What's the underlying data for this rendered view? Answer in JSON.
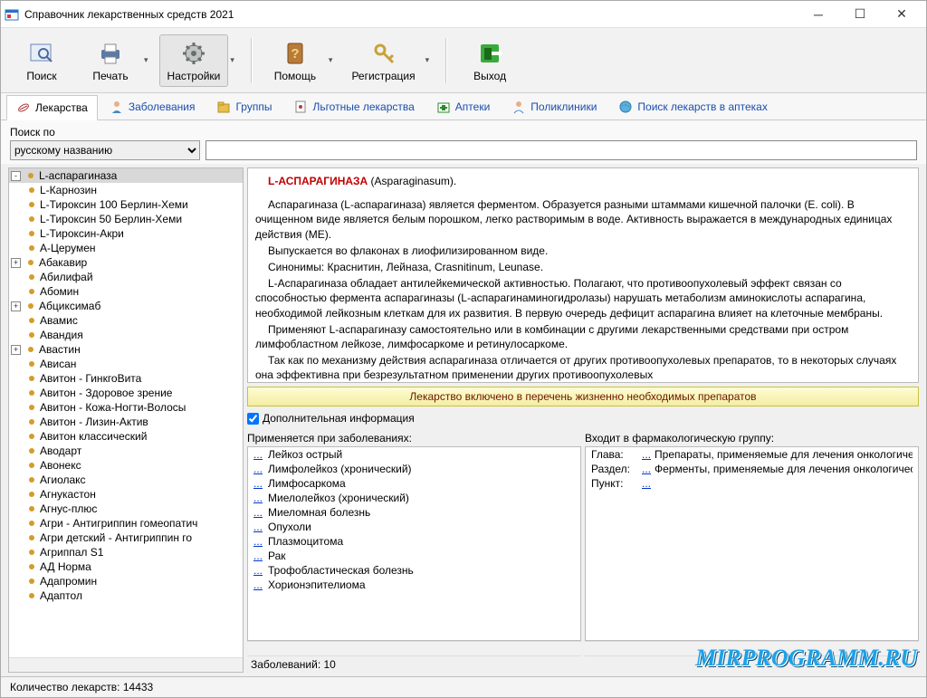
{
  "window": {
    "title": "Справочник лекарственных средств 2021"
  },
  "toolbar": {
    "search": "Поиск",
    "print": "Печать",
    "settings": "Настройки",
    "help": "Помощь",
    "register": "Регистрация",
    "exit": "Выход"
  },
  "tabs": {
    "drugs": "Лекарства",
    "diseases": "Заболевания",
    "groups": "Группы",
    "privileged": "Льготные лекарства",
    "pharmacies": "Аптеки",
    "clinics": "Поликлиники",
    "pharmsearch": "Поиск лекарств в аптеках"
  },
  "search": {
    "label": "Поиск по",
    "selected": "русскому названию",
    "value": ""
  },
  "tree": [
    {
      "label": "L-аспарагиназа",
      "expander": "-",
      "level": 0,
      "selected": true
    },
    {
      "label": "L-Карнозин",
      "level": 1
    },
    {
      "label": "L-Тироксин 100 Берлин-Хеми",
      "level": 1
    },
    {
      "label": "L-Тироксин 50 Берлин-Хеми",
      "level": 1
    },
    {
      "label": "L-Тироксин-Акри",
      "level": 1
    },
    {
      "label": "А-Церумен",
      "level": 1
    },
    {
      "label": "Абакавир",
      "expander": "+",
      "level": 0
    },
    {
      "label": "Абилифай",
      "level": 1
    },
    {
      "label": "Абомин",
      "level": 1
    },
    {
      "label": "Абциксимаб",
      "expander": "+",
      "level": 0
    },
    {
      "label": "Авамис",
      "level": 1
    },
    {
      "label": "Авандия",
      "level": 1
    },
    {
      "label": "Авастин",
      "expander": "+",
      "level": 0
    },
    {
      "label": "Ависан",
      "level": 1
    },
    {
      "label": "Авитон - ГинкгоВита",
      "level": 1
    },
    {
      "label": "Авитон - Здоровое зрение",
      "level": 1
    },
    {
      "label": "Авитон - Кожа-Ногти-Волосы",
      "level": 1
    },
    {
      "label": "Авитон - Лизин-Актив",
      "level": 1
    },
    {
      "label": "Авитон классический",
      "level": 1
    },
    {
      "label": "Аводарт",
      "level": 1
    },
    {
      "label": "Авонекс",
      "level": 1
    },
    {
      "label": "Агиолакс",
      "level": 1
    },
    {
      "label": "Агнукастон",
      "level": 1
    },
    {
      "label": "Агнус-плюс",
      "level": 1
    },
    {
      "label": "Агри - Антигриппин гомеопатич",
      "level": 1
    },
    {
      "label": "Агри детский - Антигриппин го",
      "level": 1
    },
    {
      "label": "Агриппал S1",
      "level": 1
    },
    {
      "label": "АД Норма",
      "level": 1
    },
    {
      "label": "Адапромин",
      "level": 1
    },
    {
      "label": "Адаптол",
      "level": 1
    }
  ],
  "desc": {
    "name": "L-АСПАРАГИНАЗА",
    "latin": " (Asparaginasum).",
    "p1": "Аспарагиназа (L-аспарагиназа) является ферментом. Образуется разными штаммами кишечной палочки (Е. coli). В очищенном виде является белым порошком, легко растворимым в воде. Активность выражается в международных единицах действия (МЕ).",
    "p2": "Выпускается во флаконах в лиофилизированном виде.",
    "p3": "Синонимы: Краснитин, Лейназа, Crasnitinum, Leunase.",
    "p4": "L-Аспарагиназа обладает антилейкемической активностью. Полагают, что противоопухолевый эффект связан со способностью фермента аспарагиназы (L-аспарагинаминогидролазы) нарушать метаболизм аминокислоты аспарагина, необходимой лейкозным клеткам для их развития. В первую очередь дефицит аспарагина влияет на клеточные мембраны.",
    "p5": "Применяют L-аспарагиназу самостоятельно или в комбинации с другими лекарственными средствами при остром лимфобластном лейкозе, лимфосаркоме и ретинулосаркоме.",
    "p6": "Так как по механизму действия аспарагиназа отличается от других противоопухолевых препаратов, то в некоторых случаях она эффективна при безрезультатном применении других противоопухолевых"
  },
  "vital": "Лекарство включено в перечень жизненно необходимых препаратов",
  "extra_label": "Дополнительная информация",
  "diseases_panel": {
    "label": "Применяется при заболеваниях:",
    "items": [
      "Лейкоз острый",
      "Лимфолейкоз (хронический)",
      "Лимфосаркома",
      "Миелолейкоз (хронический)",
      "Миеломная болезнь",
      "Опухоли",
      "Плазмоцитома",
      "Рак",
      "Трофобластическая болезнь",
      "Хорионэпителиома"
    ],
    "footer": "Заболеваний: 10"
  },
  "group_panel": {
    "label": "Входит в фармакологическую группу:",
    "rows": [
      {
        "k": "Глава:",
        "v": "Препараты, применяемые для лечения онкологических за"
      },
      {
        "k": "Раздел:",
        "v": "Ферменты, применяемые для лечения онкологических заб"
      },
      {
        "k": "Пункт:",
        "v": ""
      }
    ]
  },
  "status": "Количество лекарств: 14433",
  "watermark": "MIRPROGRAMM.RU",
  "dots": "..."
}
